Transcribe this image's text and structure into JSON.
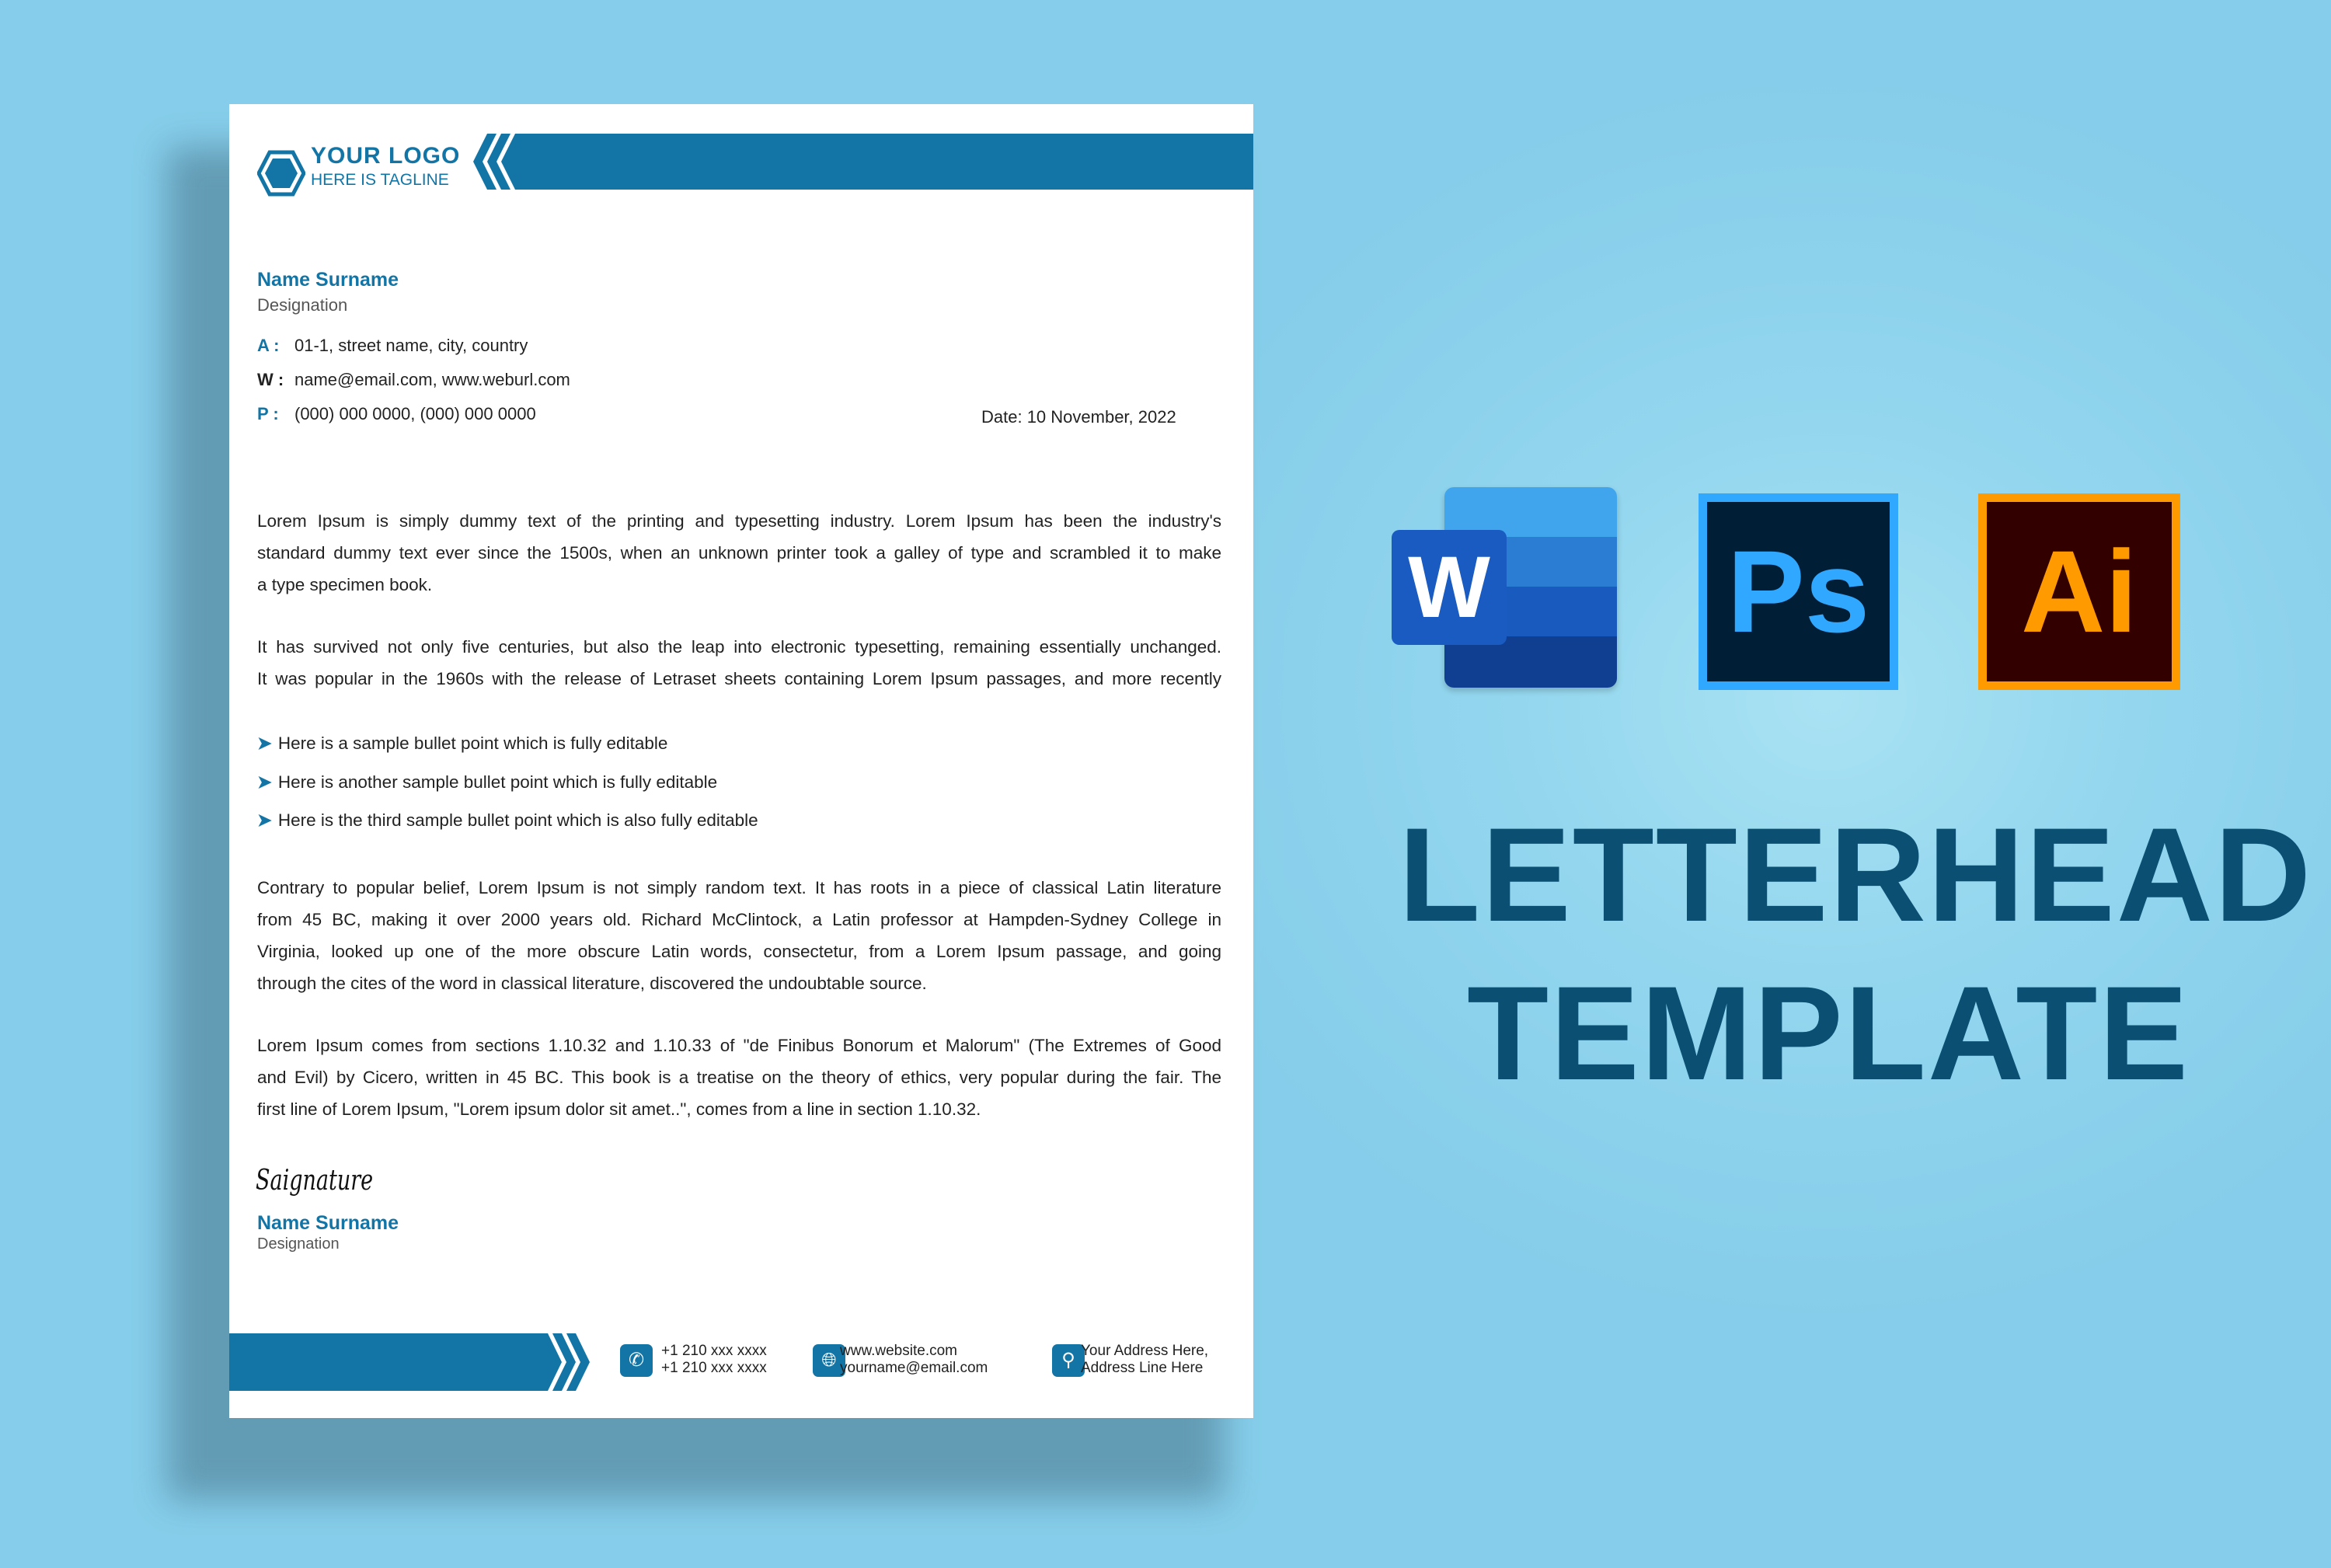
{
  "letterhead": {
    "logo": {
      "title": "YOUR LOGO",
      "tagline": "HERE IS TAGLINE"
    },
    "sender": {
      "name": "Name Surname",
      "designation": "Designation"
    },
    "contact": [
      {
        "label": "A :",
        "value": "01-1, street name, city, country"
      },
      {
        "label": "W :",
        "value": "name@email.com, www.weburl.com"
      },
      {
        "label": "P :",
        "value": "(000) 000 0000, (000) 000 0000"
      }
    ],
    "date": "Date: 10 November, 2022",
    "paragraphs": [
      [
        "Lorem Ipsum is simply dummy text of the printing and typesetting industry. Lorem Ipsum has been the industry's",
        "standard dummy text ever since the 1500s, when an unknown printer took a galley of type and scrambled it to make",
        "a type specimen book."
      ],
      [
        "It has survived not only five centuries, but also the leap into electronic typesetting, remaining essentially unchanged.",
        "It was popular in the 1960s with the release of Letraset sheets containing Lorem Ipsum passages, and more recently"
      ],
      [
        "Contrary to popular belief, Lorem Ipsum is not simply random text. It has roots in a piece of classical Latin literature",
        "from 45 BC, making it over 2000 years old. Richard McClintock, a Latin professor at Hampden-Sydney College in",
        "Virginia, looked up one of the more obscure Latin words, consectetur, from a Lorem Ipsum passage, and going",
        "through the cites of the word in classical literature, discovered the undoubtable source."
      ],
      [
        "Lorem Ipsum comes from sections 1.10.32 and 1.10.33 of \"de Finibus Bonorum et Malorum\" (The Extremes of Good",
        "and Evil) by Cicero, written in 45 BC. This book is a treatise on the theory of ethics, very popular during the fair. The",
        "first line of Lorem Ipsum, \"Lorem ipsum dolor sit amet..\", comes from a line in section 1.10.32."
      ]
    ],
    "bullets": [
      "Here is a sample bullet point which is fully editable",
      "Here is another sample bullet point which is fully editable",
      "Here is the third sample bullet point which is also fully editable"
    ],
    "signature": "Saignature",
    "signer": {
      "name": "Name Surname",
      "designation": "Designation"
    },
    "footer": {
      "phone": {
        "icon": "phone-icon",
        "lines": [
          "+1 210 xxx xxxx",
          "+1 210 xxx xxxx"
        ]
      },
      "web": {
        "icon": "globe-icon",
        "lines": [
          "www.website.com",
          "yourname@email.com"
        ]
      },
      "address": {
        "icon": "location-pin-icon",
        "lines": [
          "Your Address Here,",
          "Address Line Here"
        ]
      }
    }
  },
  "apps": {
    "word": "W",
    "photoshop": "Ps",
    "illustrator": "Ai"
  },
  "headline": [
    "LETTERHEAD",
    "TEMPLATE"
  ],
  "colors": {
    "brand": "#1275a6",
    "headline": "#0b4f73",
    "background": "#87cfea"
  }
}
